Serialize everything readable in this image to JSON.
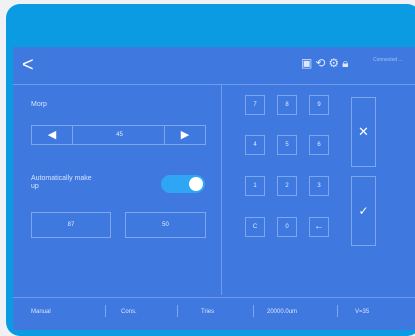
{
  "header": {
    "back_label": "<",
    "status_text": "Connected ..."
  },
  "left_panel": {
    "morp_label": "Morp",
    "stepper": {
      "decrement": "◀",
      "value": "45",
      "increment": "▶"
    },
    "toggle_label": "Automatically make up",
    "toggle_on": true,
    "field_a": "87",
    "field_b": "50"
  },
  "keypad": {
    "keys": [
      "7",
      "8",
      "9",
      "4",
      "5",
      "6",
      "1",
      "2",
      "3",
      "C",
      "0",
      "←"
    ],
    "cancel_label": "✕",
    "confirm_label": "✓"
  },
  "footer": {
    "items": [
      "Manual",
      "Cons.",
      "Tries",
      "20000.0um",
      "V=35"
    ]
  },
  "colors": {
    "device_frame": "#0b9be3",
    "screen_bg": "#3f78df",
    "toggle_on": "#2fa6f3",
    "line": "#7ea6ef"
  },
  "icons": [
    "save-icon",
    "refresh-icon",
    "settings-icon",
    "lock-icon"
  ]
}
